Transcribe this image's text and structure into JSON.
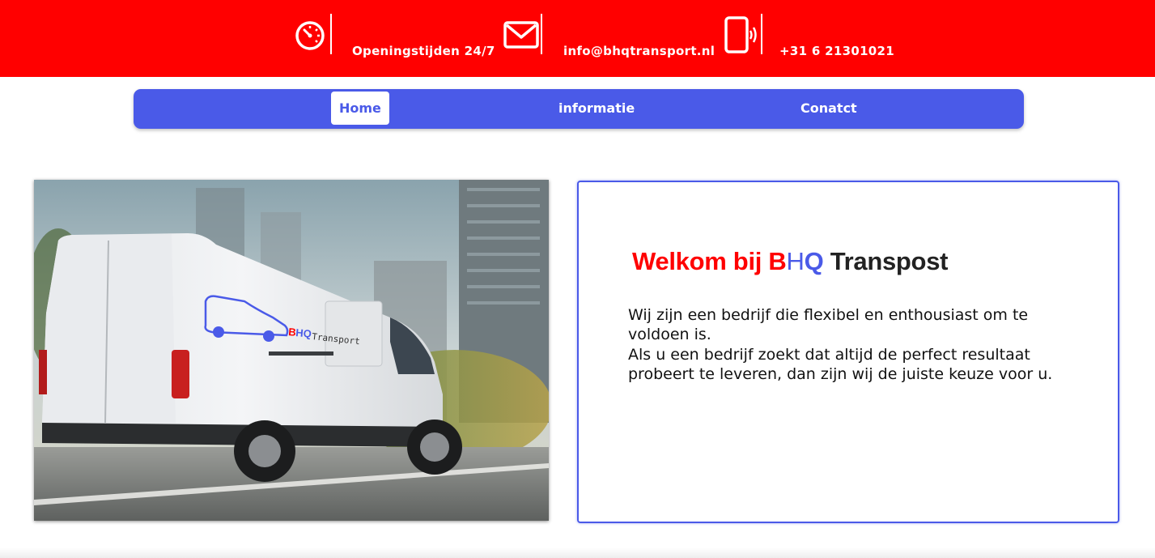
{
  "topbar": {
    "hours_label": "Openingstijden 24/7",
    "email_label": "info@bhqtransport.nl",
    "phone_label": "+31 6 21301021",
    "icons": [
      "clock-icon",
      "mail-icon",
      "phone-icon"
    ],
    "background_color": "#ff0000"
  },
  "nav": {
    "items": [
      {
        "label": "Home",
        "active": true
      },
      {
        "label": "informatie",
        "active": false
      },
      {
        "label": "Conatct",
        "active": false
      }
    ],
    "background_color": "#4a5ae8"
  },
  "hero": {
    "van_brand_b": "B",
    "van_brand_hq": "HQ",
    "van_brand_word": "Transport"
  },
  "card": {
    "title_part1": "Welkom bij ",
    "title_b": "B",
    "title_h": "H",
    "title_q": "Q",
    "title_rest": " Transpost",
    "paragraph1": "Wij zijn een bedrijf die flexibel en enthousiast om te voldoen is.",
    "paragraph2": "Als u een bedrijf zoekt dat altijd de perfect resultaat probeert te leveren, dan zijn wij de juiste keuze voor u.",
    "border_color": "#4a5ae8"
  }
}
